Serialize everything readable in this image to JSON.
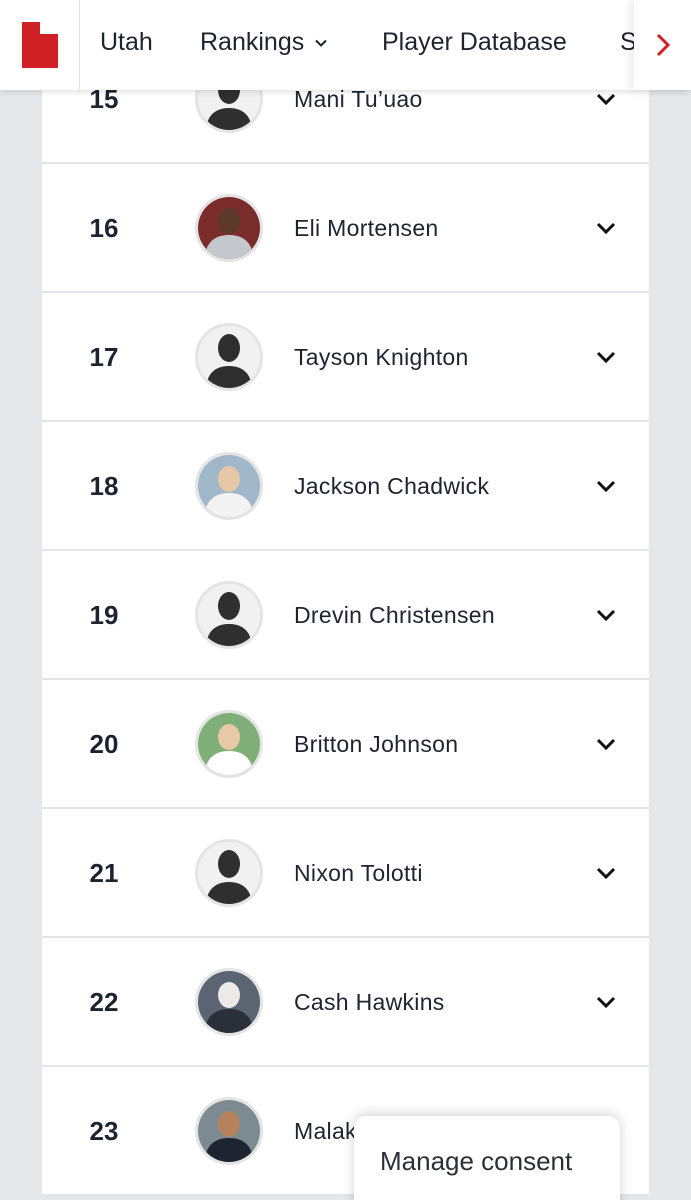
{
  "nav": {
    "logo_icon": "utah-state-icon",
    "brand_color": "#d11f26",
    "links": {
      "utah": "Utah",
      "rankings": "Rankings",
      "player_database": "Player Database",
      "cut_link": "S"
    },
    "scroll_icon": "chevron-right-icon"
  },
  "players": [
    {
      "rank": "15",
      "name": "Mani Tu’uao",
      "photo": "silhouette"
    },
    {
      "rank": "16",
      "name": "Eli Mortensen",
      "photo": "photo"
    },
    {
      "rank": "17",
      "name": "Tayson Knighton",
      "photo": "silhouette"
    },
    {
      "rank": "18",
      "name": "Jackson Chadwick",
      "photo": "photo"
    },
    {
      "rank": "19",
      "name": "Drevin Christensen",
      "photo": "silhouette"
    },
    {
      "rank": "20",
      "name": "Britton Johnson",
      "photo": "photo"
    },
    {
      "rank": "21",
      "name": "Nixon Tolotti",
      "photo": "silhouette"
    },
    {
      "rank": "22",
      "name": "Cash Hawkins",
      "photo": "photo"
    },
    {
      "rank": "23",
      "name": "Malak",
      "photo": "photo"
    }
  ],
  "consent": {
    "label": "Manage consent"
  }
}
